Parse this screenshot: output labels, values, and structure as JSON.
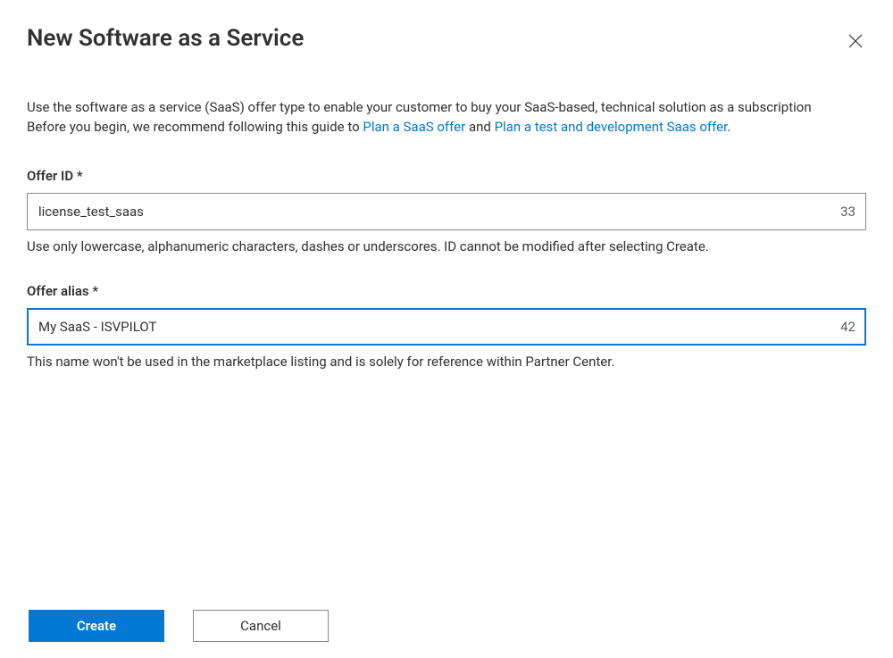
{
  "header": {
    "title": "New Software as a Service"
  },
  "description": {
    "line1": "Use the software as a service (SaaS) offer type to enable your customer to buy your SaaS-based, technical solution as a subscription",
    "line2_prefix": "Before you begin, we recommend following this guide to ",
    "link1": "Plan a SaaS offer",
    "line2_mid": " and ",
    "link2": "Plan a test and development Saas offer",
    "line2_suffix": "."
  },
  "fields": {
    "offer_id": {
      "label": "Offer ID *",
      "value": "license_test_saas",
      "char_count": "33",
      "help": "Use only lowercase, alphanumeric characters, dashes or underscores. ID cannot be modified after selecting Create."
    },
    "offer_alias": {
      "label": "Offer alias *",
      "value": "My SaaS - ISVPILOT",
      "char_count": "42",
      "help": "This name won't be used in the marketplace listing and is solely for reference within Partner Center."
    }
  },
  "buttons": {
    "create": "Create",
    "cancel": "Cancel"
  }
}
